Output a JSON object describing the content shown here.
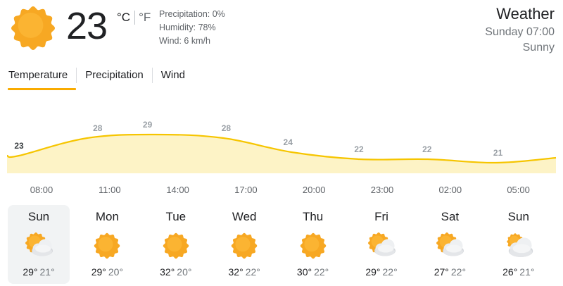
{
  "current": {
    "temperature": "23",
    "unit_c": "°C",
    "unit_f": "°F",
    "icon": "sun-icon",
    "precipitation": "Precipitation: 0%",
    "humidity": "Humidity: 78%",
    "wind": "Wind: 6 km/h"
  },
  "header": {
    "title": "Weather",
    "datetime": "Sunday 07:00",
    "condition": "Sunny"
  },
  "tabs": [
    {
      "label": "Temperature",
      "active": true
    },
    {
      "label": "Precipitation",
      "active": false
    },
    {
      "label": "Wind",
      "active": false
    }
  ],
  "colors": {
    "accent": "#f9ab00",
    "line": "#f6c500",
    "fill": "#fdf3c6",
    "sun": "#f7a823",
    "label": "#9aa0a6"
  },
  "chart_data": {
    "type": "area",
    "x": [
      "08:00",
      "11:00",
      "14:00",
      "17:00",
      "20:00",
      "23:00",
      "02:00",
      "05:00"
    ],
    "values": [
      23,
      28,
      29,
      28,
      24,
      22,
      22,
      21
    ],
    "title": "",
    "xlabel": "",
    "ylabel": "",
    "grid": false
  },
  "days": [
    {
      "name": "Sun",
      "icon": "partly-cloudy-icon",
      "high": "29°",
      "low": "21°",
      "selected": true
    },
    {
      "name": "Mon",
      "icon": "sun-icon",
      "high": "29°",
      "low": "20°",
      "selected": false
    },
    {
      "name": "Tue",
      "icon": "sun-icon",
      "high": "32°",
      "low": "20°",
      "selected": false
    },
    {
      "name": "Wed",
      "icon": "sun-icon",
      "high": "32°",
      "low": "22°",
      "selected": false
    },
    {
      "name": "Thu",
      "icon": "sun-icon",
      "high": "30°",
      "low": "22°",
      "selected": false
    },
    {
      "name": "Fri",
      "icon": "partly-cloudy-icon",
      "high": "29°",
      "low": "22°",
      "selected": false
    },
    {
      "name": "Sat",
      "icon": "partly-cloudy-icon",
      "high": "27°",
      "low": "22°",
      "selected": false
    },
    {
      "name": "Sun",
      "icon": "mostly-cloudy-icon",
      "high": "26°",
      "low": "21°",
      "selected": false
    }
  ]
}
